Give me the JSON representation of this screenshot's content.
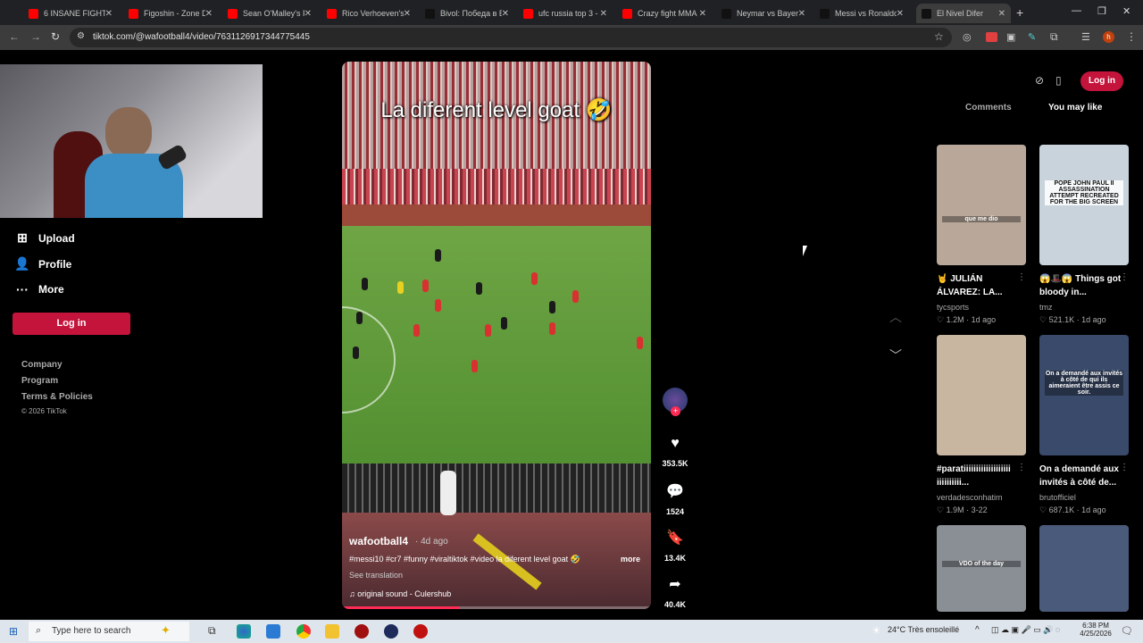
{
  "browser": {
    "tabs": [
      {
        "title": "6 INSANE FIGHTS",
        "color": "#ff0000"
      },
      {
        "title": "Figoshin - Zone D",
        "color": "#ff0000"
      },
      {
        "title": "Sean O'Malley's F",
        "color": "#ff0000"
      },
      {
        "title": "Rico Verhoeven's",
        "color": "#ff0000"
      },
      {
        "title": "Bivol: Победа в Б",
        "color": "#111111"
      },
      {
        "title": "ufc russia top 3 -",
        "color": "#ff0000"
      },
      {
        "title": "Crazy fight MMA",
        "color": "#ff0000"
      },
      {
        "title": "Neymar vs Bayern",
        "color": "#111111"
      },
      {
        "title": "Messi vs Ronaldo",
        "color": "#111111"
      },
      {
        "title": "El Nivel Difer",
        "color": "#111111"
      }
    ],
    "url": "tiktok.com/@wafootball4/video/7631126917344775445",
    "new_tab": "+",
    "profile_initial": "h"
  },
  "sidebar": {
    "items": [
      {
        "label": "Upload",
        "icon": "⊞"
      },
      {
        "label": "Profile",
        "icon": "👤"
      },
      {
        "label": "More",
        "icon": "···"
      }
    ],
    "login_label": "Log in",
    "footer": [
      "Company",
      "Program",
      "Terms & Policies",
      "© 2026 TikTok"
    ]
  },
  "video": {
    "caption": "La diferent level goat 🤣",
    "author": "wafootball4",
    "age": "· 4d ago",
    "description": "#messi10 #cr7 #funny #viraltiktok #video  la diferent level goat 🤣",
    "more": "more",
    "see_translation": "See translation",
    "sound": "♫  original sound - Culershub",
    "progress": 0.38
  },
  "actions": {
    "likes": "353.5K",
    "comments": "1524",
    "saves": "13.4K",
    "shares": "40.4K"
  },
  "right": {
    "login_label": "Log in",
    "tabs": {
      "comments": "Comments",
      "you_may_like": "You may like"
    },
    "cards": [
      {
        "title": "🤘 JULIÁN ÁLVAREZ: LA...",
        "author": "tycsports",
        "likes": "♡ 1.2M",
        "date": "· 1d ago",
        "thumb_color": "#b9a89a",
        "overlay": "que me dio"
      },
      {
        "title": "😱🎩😱 Things got bloody in...",
        "author": "tmz",
        "likes": "♡ 521.1K",
        "date": "· 1d ago",
        "thumb_color": "#c9d3dc",
        "overlay": "POPE JOHN PAUL II ASSASSINATION ATTEMPT RECREATED FOR THE BIG SCREEN"
      },
      {
        "title": "#paratiiiiiiiiiiiiiiiiiii iiiiiiiiii...",
        "author": "verdadesconhatim",
        "likes": "♡ 1.9M",
        "date": "· 3-22",
        "thumb_color": "#c8b6a0",
        "overlay": ""
      },
      {
        "title": "On a demandé aux invités à côté de...",
        "author": "brutofficiel",
        "likes": "♡ 687.1K",
        "date": "· 1d ago",
        "thumb_color": "#3a4a6a",
        "overlay": "On a demandé aux invités à côté de qui ils aimeraient être assis ce soir."
      },
      {
        "title": "",
        "author": "",
        "likes": "",
        "date": "",
        "thumb_color": "#8a8f95",
        "overlay": "VDO of the day"
      },
      {
        "title": "",
        "author": "",
        "likes": "",
        "date": "",
        "thumb_color": "#4a5a7a",
        "overlay": ""
      }
    ]
  },
  "taskbar": {
    "search_placeholder": "Type here to search",
    "weather": "24°C  Très ensoleillé",
    "time": "6:38 PM",
    "date": "4/25/2026"
  }
}
